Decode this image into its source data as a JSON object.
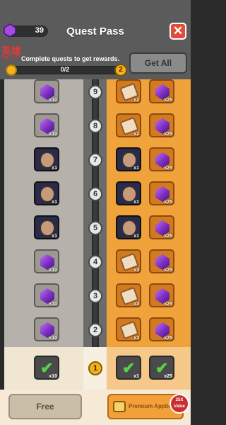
{
  "header": {
    "gem_count": "39",
    "title": "Quest Pass",
    "watermark": "英雄",
    "watermark_sub": "英雄 1 9 9",
    "subtitle": "Complete quests to get rewards.",
    "progress_text": "0/2",
    "progress_fraction": 0.0,
    "level_badge": "2",
    "get_all_label": "Get All"
  },
  "rows": [
    {
      "level": "9",
      "free": {
        "item": "gem",
        "mult": "x10"
      },
      "prem": [
        {
          "item": "scroll",
          "mult": "x2"
        },
        {
          "item": "gem",
          "mult": "x25"
        }
      ]
    },
    {
      "level": "8",
      "free": {
        "item": "gem",
        "mult": "x10"
      },
      "prem": [
        {
          "item": "scroll",
          "mult": "x2"
        },
        {
          "item": "gem",
          "mult": "x25"
        }
      ]
    },
    {
      "level": "7",
      "free": {
        "item": "hero",
        "mult": "x1"
      },
      "prem": [
        {
          "item": "hero",
          "mult": "x1"
        },
        {
          "item": "gem",
          "mult": "x25"
        }
      ]
    },
    {
      "level": "6",
      "free": {
        "item": "hero",
        "mult": "x1"
      },
      "prem": [
        {
          "item": "hero",
          "mult": "x1"
        },
        {
          "item": "gem",
          "mult": "x25"
        }
      ]
    },
    {
      "level": "5",
      "free": {
        "item": "hero",
        "mult": "x1"
      },
      "prem": [
        {
          "item": "hero",
          "mult": "x1"
        },
        {
          "item": "gem",
          "mult": "x25"
        }
      ]
    },
    {
      "level": "4",
      "free": {
        "item": "gem",
        "mult": "x10"
      },
      "prem": [
        {
          "item": "scroll",
          "mult": "x3"
        },
        {
          "item": "gem",
          "mult": "x25"
        }
      ]
    },
    {
      "level": "3",
      "free": {
        "item": "gem",
        "mult": "x10"
      },
      "prem": [
        {
          "item": "scroll",
          "mult": "x3"
        },
        {
          "item": "gem",
          "mult": "x25"
        }
      ]
    },
    {
      "level": "2",
      "free": {
        "item": "gem",
        "mult": "x10"
      },
      "prem": [
        {
          "item": "scroll",
          "mult": "x3"
        },
        {
          "item": "gem",
          "mult": "x25"
        }
      ]
    }
  ],
  "completed_row": {
    "level": "1",
    "free_mult": "x10",
    "prem_mults": [
      "x1",
      "x25"
    ]
  },
  "footer": {
    "free_label": "Free",
    "premium_label": "Premium Applied",
    "value_badge_line1": "25X",
    "value_badge_line2": "Value"
  }
}
